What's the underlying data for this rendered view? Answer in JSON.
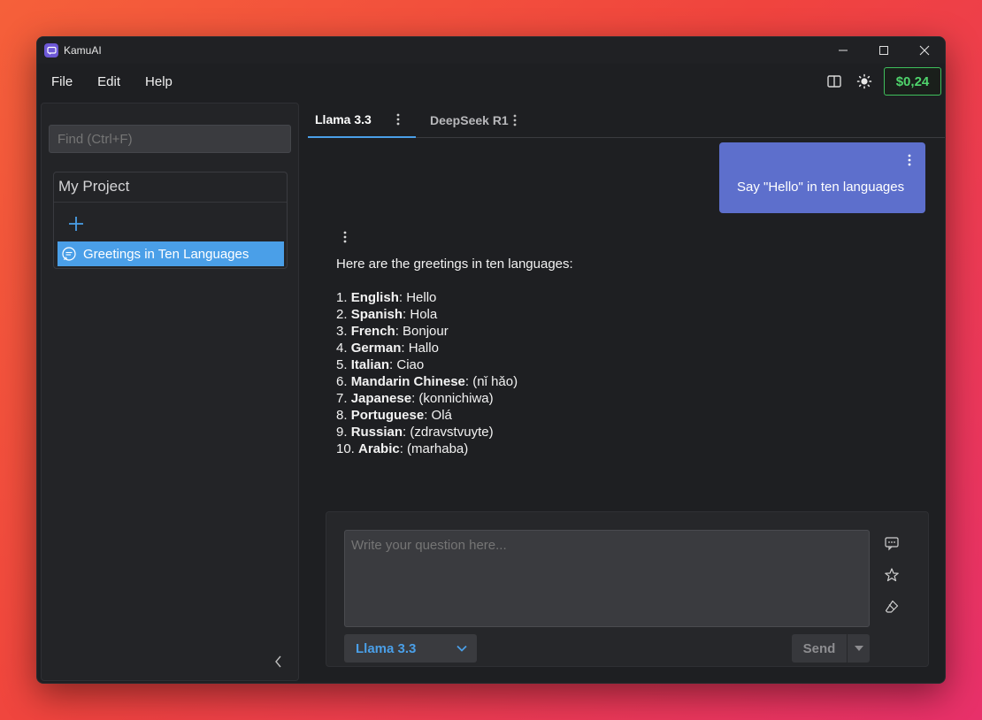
{
  "window": {
    "title": "KamuAI"
  },
  "menu": {
    "items": [
      "File",
      "Edit",
      "Help"
    ]
  },
  "toolbar": {
    "credit": "$0,24",
    "icons": [
      "split-view-icon",
      "theme-sun-icon"
    ]
  },
  "sidebar": {
    "search_placeholder": "Find (Ctrl+F)",
    "project": {
      "title": "My Project",
      "conversations": [
        {
          "label": "Greetings in Ten Languages",
          "selected": true
        }
      ]
    }
  },
  "tabs": [
    {
      "label": "Llama 3.3",
      "active": true
    },
    {
      "label": "DeepSeek R1",
      "active": false
    }
  ],
  "chat": {
    "user_message": "Say \"Hello\" in ten languages",
    "assistant_intro": "Here are the greetings in ten languages:",
    "assistant_list": [
      {
        "num": "1.",
        "lang": "English",
        "greeting": ": Hello"
      },
      {
        "num": "2.",
        "lang": "Spanish",
        "greeting": ": Hola"
      },
      {
        "num": "3.",
        "lang": "French",
        "greeting": ": Bonjour"
      },
      {
        "num": "4.",
        "lang": "German",
        "greeting": ": Hallo"
      },
      {
        "num": "5.",
        "lang": "Italian",
        "greeting": ": Ciao"
      },
      {
        "num": "6.",
        "lang": "Mandarin Chinese",
        "greeting": ": (nǐ hǎo)"
      },
      {
        "num": "7.",
        "lang": "Japanese",
        "greeting": ": (konnichiwa)"
      },
      {
        "num": "8.",
        "lang": "Portuguese",
        "greeting": ": Olá"
      },
      {
        "num": "9.",
        "lang": "Russian",
        "greeting": ": (zdravstvuyte)"
      },
      {
        "num": "10.",
        "lang": "Arabic",
        "greeting": ": (marhaba)"
      }
    ]
  },
  "composer": {
    "placeholder": "Write your question here...",
    "model": "Llama 3.3",
    "send_label": "Send"
  },
  "colors": {
    "accent": "#4a9fe8",
    "user_bubble": "#5d6fcc",
    "credit_green": "#4fd46c"
  }
}
